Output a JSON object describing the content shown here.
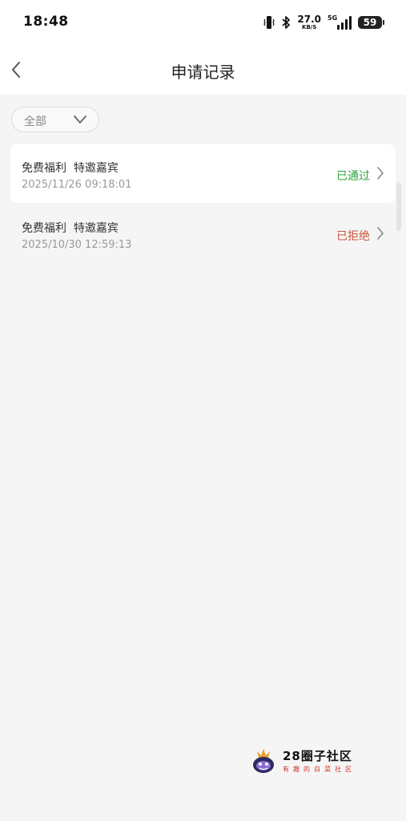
{
  "status_bar": {
    "time": "18:48",
    "net_speed_value": "27.0",
    "net_speed_unit": "KB/S",
    "network_type": "5G",
    "battery": "59",
    "icons": [
      "vibrate-icon",
      "bluetooth-icon",
      "signal-icon",
      "battery-icon"
    ]
  },
  "nav": {
    "title": "申请记录",
    "back_icon": "chevron-left-icon"
  },
  "filter": {
    "selected": "全部",
    "icon": "chevron-down-icon"
  },
  "records": [
    {
      "name": "免费福利  特邀嘉宾",
      "date": "2025/11/26 09:18:01",
      "status": "已通过",
      "status_color": "#2ea33a"
    },
    {
      "name": "免费福利  特邀嘉宾",
      "date": "2025/10/30 12:59:13",
      "status": "已拒绝",
      "status_color": "#c8553d"
    }
  ],
  "watermark": {
    "title": "28圈子社区",
    "subtitle": "有趣的白菜社区"
  },
  "colors": {
    "background": "#f5f5f5",
    "card": "#ffffff",
    "approved": "#2ea33a",
    "rejected": "#c8553d",
    "watermark_accent": "#d0342c"
  }
}
